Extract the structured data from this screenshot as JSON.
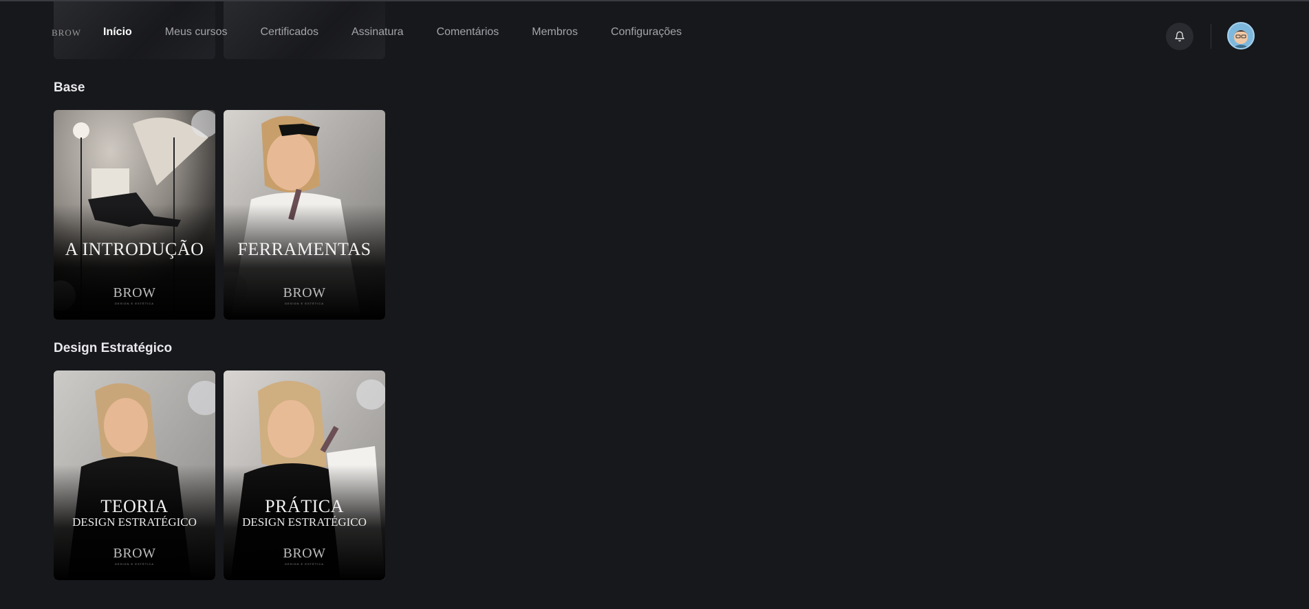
{
  "header": {
    "logo_text": "BROW",
    "nav": [
      {
        "label": "Início",
        "active": true
      },
      {
        "label": "Meus cursos",
        "active": false
      },
      {
        "label": "Certificados",
        "active": false
      },
      {
        "label": "Assinatura",
        "active": false
      },
      {
        "label": "Comentários",
        "active": false
      },
      {
        "label": "Membros",
        "active": false
      },
      {
        "label": "Configurações",
        "active": false
      }
    ],
    "icons": {
      "notifications": "bell-icon",
      "profile": "avatar"
    }
  },
  "sections": [
    {
      "title": "Base",
      "cards": [
        {
          "title": "A INTRODUÇÃO",
          "subtitle": "",
          "brand": "BROW",
          "brand_sub": "DESIGN E ESTÉTICA"
        },
        {
          "title": "FERRAMENTAS",
          "subtitle": "",
          "brand": "BROW",
          "brand_sub": "DESIGN E ESTÉTICA"
        }
      ]
    },
    {
      "title": "Design Estratégico",
      "cards": [
        {
          "title": "TEORIA",
          "subtitle": "DESIGN ESTRATÉGICO",
          "brand": "BROW",
          "brand_sub": "DESIGN E ESTÉTICA"
        },
        {
          "title": "PRÁTICA",
          "subtitle": "DESIGN ESTRATÉGICO",
          "brand": "BROW",
          "brand_sub": "DESIGN E ESTÉTICA"
        }
      ]
    }
  ],
  "colors": {
    "background": "#17181c",
    "nav_active": "#ffffff",
    "nav_inactive": "#a4a5aa",
    "avatar_ring": "#a6d2ee"
  }
}
